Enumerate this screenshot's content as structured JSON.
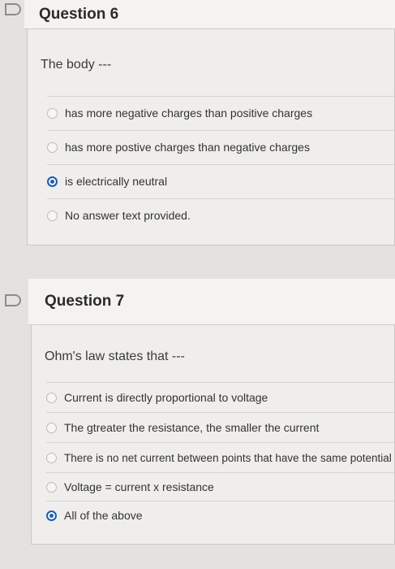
{
  "q6": {
    "title": "Question 6",
    "prompt": "The body ---",
    "answers": [
      {
        "label": "has more negative charges than positive charges",
        "selected": false
      },
      {
        "label": "has more postive charges than negative charges",
        "selected": false
      },
      {
        "label": "is electrically neutral",
        "selected": true
      },
      {
        "label": "No answer text provided.",
        "selected": false
      }
    ]
  },
  "q7": {
    "title": "Question 7",
    "prompt": "Ohm's law states that ---",
    "answers": [
      {
        "label": "Current is directly proportional to voltage",
        "selected": false
      },
      {
        "label": "The gtreater the resistance, the smaller the current",
        "selected": false
      },
      {
        "label": "There is no net current between points that have the same potential",
        "selected": false
      },
      {
        "label": "Voltage = current x resistance",
        "selected": false
      },
      {
        "label": "All of the above",
        "selected": true
      }
    ]
  },
  "colors": {
    "accent": "#1f5fb0",
    "background": "#e4e2df"
  }
}
